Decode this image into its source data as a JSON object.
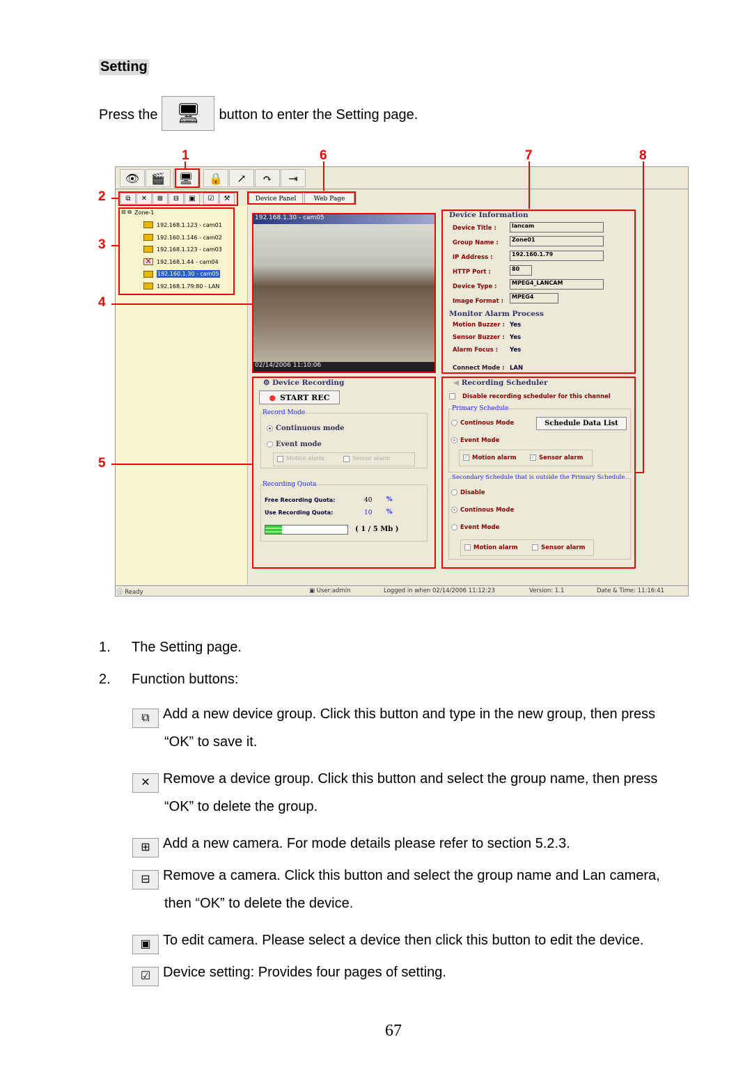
{
  "heading": "Setting",
  "intro": {
    "before": "Press the",
    "after": "button to enter the Setting page."
  },
  "annotations": [
    "1",
    "2",
    "3",
    "4",
    "5",
    "6",
    "7",
    "8"
  ],
  "app": {
    "toolbar": [
      "eye-icon",
      "camera-icon",
      "setting-icon",
      "lock-icon",
      "user-icon",
      "arrow-icon",
      "exit-icon"
    ],
    "function_buttons": [
      "add-group-icon",
      "remove-group-icon",
      "add-camera-icon",
      "remove-camera-icon",
      "edit-camera-icon",
      "device-setting-icon",
      "tools-icon"
    ],
    "tabs": [
      "Device Panel",
      "Web Page"
    ],
    "tree": {
      "root": "Zone-1",
      "items": [
        "192.168.1.123 - cam01",
        "192.160.1.146 - cam02",
        "192.168.1.123 - cam03",
        "192.168.1.44 - cam04",
        "192.160.1.30 - cam05",
        "192.168.1.79:80 - LAN"
      ],
      "selected": 4
    },
    "video": {
      "title": "192.168.1.30 - cam05",
      "timestamp": "02/14/2006 11:10:06"
    },
    "device_info": {
      "title": "Device Information",
      "fields": [
        {
          "label": "Device Title :",
          "value": "lancam"
        },
        {
          "label": "Group Name :",
          "value": "Zone01"
        },
        {
          "label": "IP Address :",
          "value": "192.160.1.79"
        },
        {
          "label": "HTTP Port :",
          "value": "80"
        },
        {
          "label": "Device Type :",
          "value": "MPEG4_LANCAM"
        },
        {
          "label": "Image Format :",
          "value": "MPEG4"
        }
      ],
      "alarm_title": "Monitor Alarm Process",
      "alarm": [
        {
          "label": "Motion Buzzer :",
          "value": "Yes"
        },
        {
          "label": "Sensor Buzzer :",
          "value": "Yes"
        },
        {
          "label": "Alarm Focus :",
          "value": "Yes"
        }
      ],
      "connect": {
        "label": "Connect Mode :",
        "value": "LAN"
      }
    },
    "recording": {
      "title": "Device Recording",
      "start": "START REC",
      "mode_title": "Record Mode",
      "continuous": "Continuous mode",
      "event": "Event mode",
      "motion": "Motion alarm",
      "sensor": "Sensor alarm",
      "quota_title": "Recording Quota",
      "free_label": "Free Recording Quota:",
      "free": "40",
      "use_label": "Use Recording Quota:",
      "use": "10",
      "pct": "%",
      "usage": "( 1 / 5 Mb )",
      "progress": 0.2
    },
    "scheduler": {
      "title": "Recording Scheduler",
      "disable": "Disable recording scheduler for this channel",
      "primary": "Primary Schedule",
      "continous": "Continous Mode",
      "list_button": "Schedule Data List",
      "event": "Event Mode",
      "motion": "Motion alarm",
      "sensor": "Sensor alarm",
      "secondary": "Secondary Schedule that is outside the Primary Schedule",
      "disable_opt": "Disable",
      "continous2": "Continous Mode",
      "event2": "Event Mode"
    },
    "status": {
      "ready": "Ready",
      "user": "User:admin",
      "logged": "Logged in when 02/14/2006 11:12:23",
      "version_label": "Version:",
      "version": "1.1",
      "dt_label": "Date & Time:",
      "time": "11:16:41"
    }
  },
  "list": [
    {
      "n": "1.",
      "text": "The Setting page."
    },
    {
      "n": "2.",
      "text": "Function buttons:"
    }
  ],
  "descriptions": [
    {
      "icon": "add-group-icon",
      "l1": "Add a new device group. Click this button and type in the new group, then press",
      "l2": "“OK” to save it."
    },
    {
      "icon": "remove-group-icon",
      "l1": "Remove a device group. Click this button and select the group name, then press",
      "l2": "“OK” to delete the group."
    },
    {
      "icon": "add-camera-icon",
      "l1": "Add a new camera. For mode details please refer to section 5.2.3.",
      "l2": ""
    },
    {
      "icon": "remove-camera-icon",
      "l1": "Remove a camera. Click this button and select the group name and Lan camera,",
      "l2": "then “OK” to delete the device."
    },
    {
      "icon": "edit-camera-icon",
      "l1": "To edit camera. Please select a device then click this button to edit the device.",
      "l2": ""
    },
    {
      "icon": "device-setting-icon",
      "l1": "Device setting: Provides four pages of setting.",
      "l2": ""
    }
  ],
  "page_number": "67"
}
